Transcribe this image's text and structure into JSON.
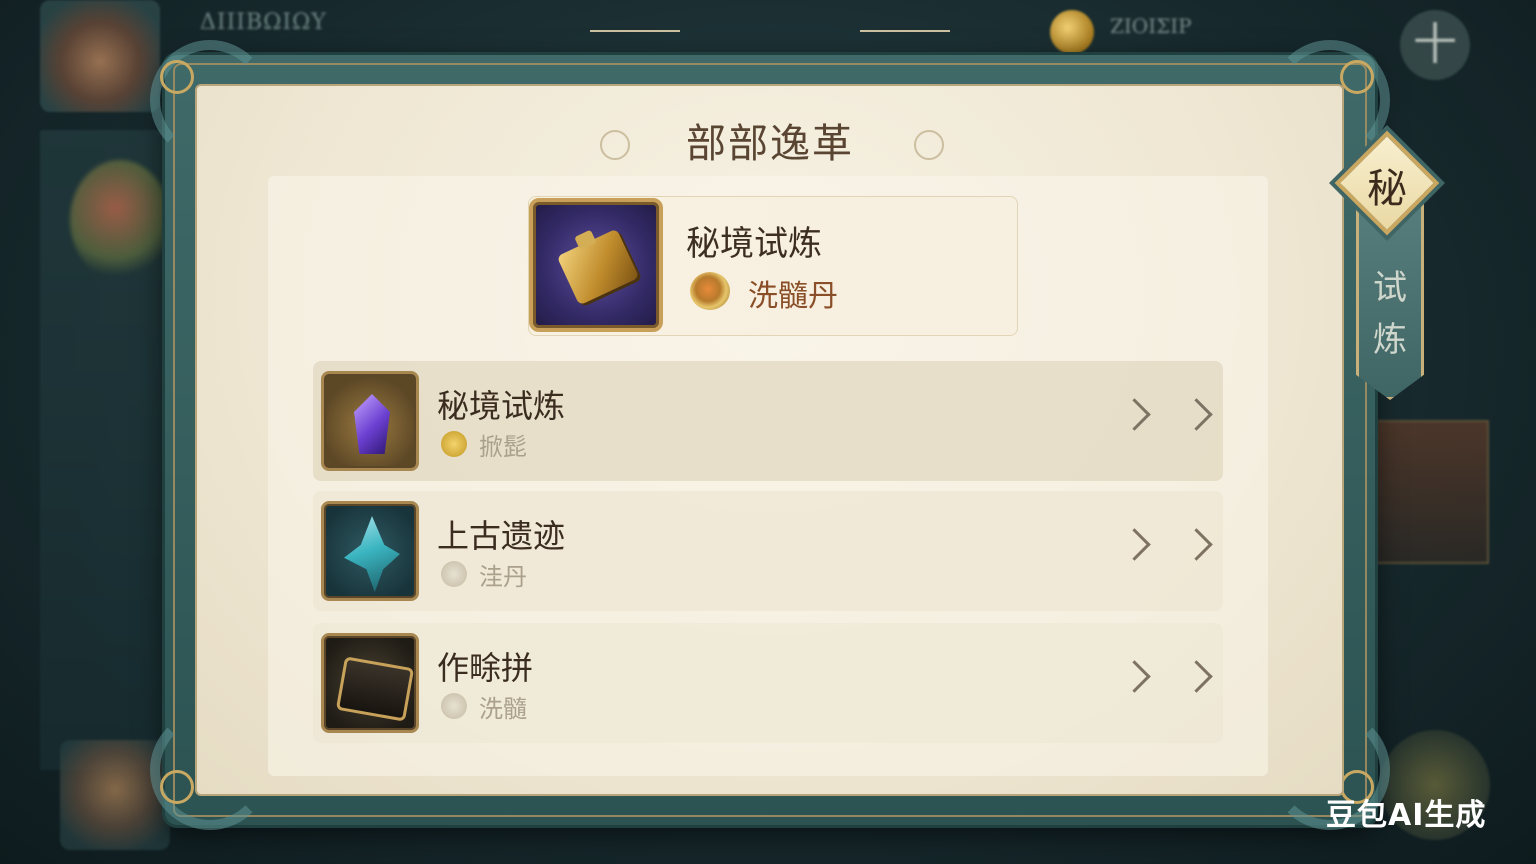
{
  "background": {
    "top_left_text": "ΔΙΙΙΒΩΙΩΥ",
    "coin_text": "ΖΙΟΙΣΙΡ",
    "plus_label": "十"
  },
  "dialog": {
    "title": "部部逸革",
    "featured": {
      "title": "秘境试炼",
      "reward": "洗髓丹"
    },
    "list": [
      {
        "title": "秘境试炼",
        "subtitle": "掀髭"
      },
      {
        "title": "上古遗迹",
        "subtitle": "洼丹"
      },
      {
        "title": "作畭拼",
        "subtitle": "洗髓"
      }
    ]
  },
  "side_tab": {
    "badge": "秘",
    "label_line1": "试",
    "label_line2": "炼"
  },
  "watermark": "豆包AI生成",
  "colors": {
    "frame_teal": "#3f6a69",
    "parchment": "#f2ead8",
    "gold": "#c8a05a",
    "title_brown": "#5a4432",
    "reward_orange": "#8a4f28"
  }
}
